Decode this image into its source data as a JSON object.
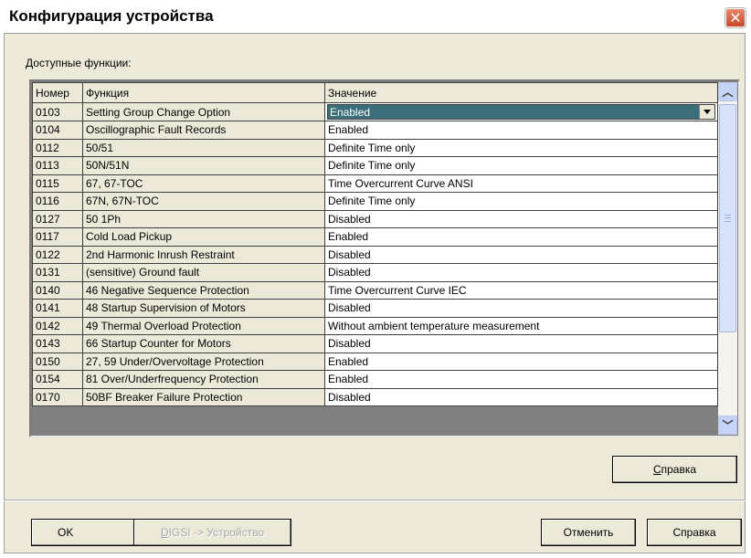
{
  "window": {
    "title": "Конфигурация устройства",
    "close_glyph": "✕"
  },
  "section": {
    "label_accel": "Д",
    "label_rest": "оступные функции:"
  },
  "table": {
    "columns": [
      "Номер",
      "Функция",
      "Значение"
    ],
    "rows": [
      {
        "num": "0103",
        "func": "Setting Group Change Option",
        "value": "Enabled"
      },
      {
        "num": "0104",
        "func": "Oscillographic Fault Records",
        "value": "Enabled"
      },
      {
        "num": "0112",
        "func": "50/51",
        "value": "Definite Time only"
      },
      {
        "num": "0113",
        "func": "50N/51N",
        "value": "Definite Time only"
      },
      {
        "num": "0115",
        "func": "67, 67-TOC",
        "value": "Time Overcurrent Curve  ANSI"
      },
      {
        "num": "0116",
        "func": "67N, 67N-TOC",
        "value": "Definite Time only"
      },
      {
        "num": "0127",
        "func": "50 1Ph",
        "value": "Disabled"
      },
      {
        "num": "0117",
        "func": "Cold Load Pickup",
        "value": "Enabled"
      },
      {
        "num": "0122",
        "func": "2nd Harmonic Inrush Restraint",
        "value": "Disabled"
      },
      {
        "num": "0131",
        "func": "(sensitive) Ground fault",
        "value": "Disabled"
      },
      {
        "num": "0140",
        "func": "46 Negative Sequence  Protection",
        "value": "Time Overcurrent Curve IEC"
      },
      {
        "num": "0141",
        "func": "48 Startup Supervision of Motors",
        "value": "Disabled"
      },
      {
        "num": "0142",
        "func": "49 Thermal Overload Protection",
        "value": "Without ambient temperature measurement"
      },
      {
        "num": "0143",
        "func": "66 Startup Counter for Motors",
        "value": "Disabled"
      },
      {
        "num": "0150",
        "func": "27, 59  Under/Overvoltage Protection",
        "value": "Enabled"
      },
      {
        "num": "0154",
        "func": "81 Over/Underfrequency Protection",
        "value": "Enabled"
      },
      {
        "num": "0170",
        "func": "50BF Breaker Failure Protection",
        "value": "Disabled"
      }
    ],
    "selected_row_index": 0,
    "selected_value": "Enabled"
  },
  "buttons": {
    "help_top_accel": "С",
    "help_top_rest": "правка",
    "ok": "OK",
    "digsi_accel": "D",
    "digsi_rest": "IGSI -> Устройство",
    "cancel": "Отменить",
    "help_bottom": "Справка"
  }
}
